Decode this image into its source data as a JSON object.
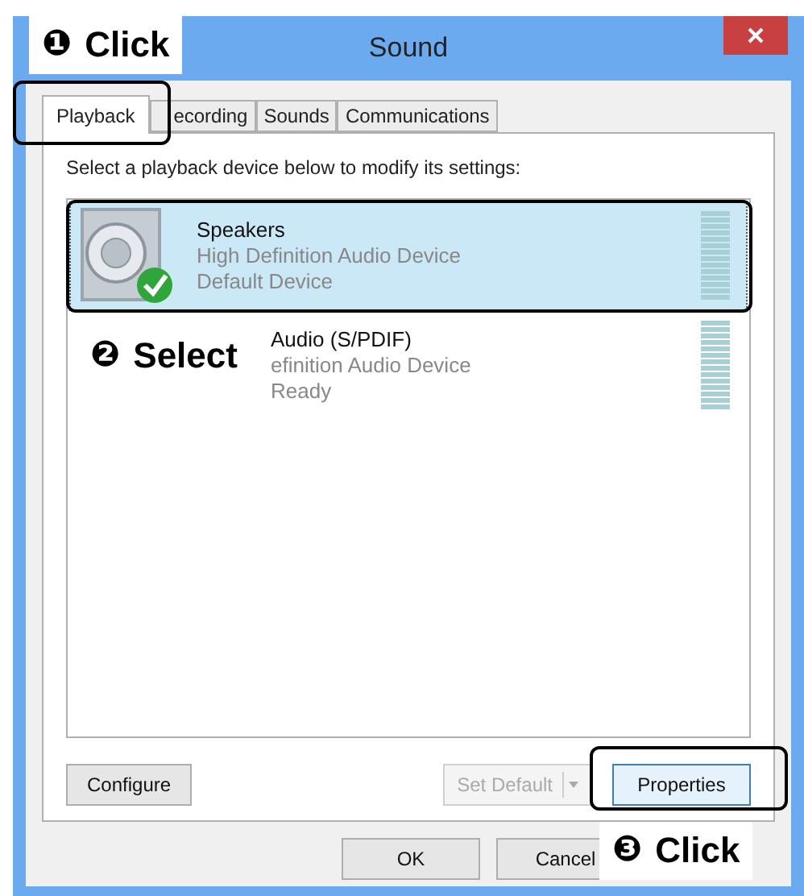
{
  "window": {
    "title": "Sound"
  },
  "tabs": [
    {
      "label": "Playback",
      "selected": true
    },
    {
      "label": "ecording",
      "selected": false
    },
    {
      "label": "Sounds",
      "selected": false
    },
    {
      "label": "Communications",
      "selected": false
    }
  ],
  "instruction": "Select a playback device below to modify its settings:",
  "devices": [
    {
      "kind": "default",
      "name": "Speakers",
      "driver": "High Definition Audio Device",
      "status": "Default Device",
      "selected": true
    },
    {
      "kind": "covered",
      "name": "Audio (S/PDIF)",
      "driver": "efinition Audio Device",
      "status": "Ready",
      "selected": false
    }
  ],
  "buttons": [
    {
      "kind": "plain",
      "label": "Configure",
      "disabled": false,
      "focused": false
    },
    {
      "kind": "split",
      "label": "Set Default",
      "disabled": true,
      "focused": false
    },
    {
      "kind": "plain",
      "label": "Properties",
      "disabled": false,
      "focused": true
    }
  ],
  "dialog_buttons": [
    {
      "label": "OK"
    },
    {
      "label": "Cancel"
    }
  ],
  "callouts": [
    {
      "number": "❶",
      "text": "Click"
    },
    {
      "number": "❷",
      "text": "Select"
    },
    {
      "number": "❸",
      "text": "Click"
    }
  ]
}
